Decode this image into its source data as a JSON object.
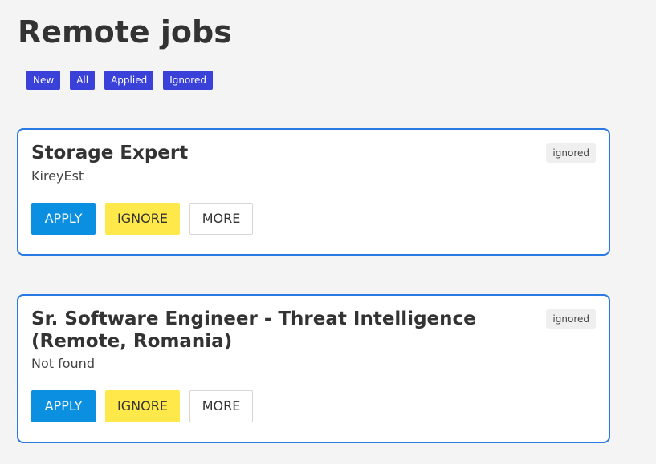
{
  "page": {
    "title": "Remote jobs"
  },
  "filters": [
    {
      "label": "New"
    },
    {
      "label": "All"
    },
    {
      "label": "Applied"
    },
    {
      "label": "Ignored"
    }
  ],
  "jobs": [
    {
      "title": "Storage Expert",
      "company": "KireyEst",
      "status": "ignored",
      "actions": {
        "apply": "APPLY",
        "ignore": "IGNORE",
        "more": "MORE"
      }
    },
    {
      "title": "Sr. Software Engineer - Threat Intelligence (Remote, Romania)",
      "company": "Not found",
      "status": "ignored",
      "actions": {
        "apply": "APPLY",
        "ignore": "IGNORE",
        "more": "MORE"
      }
    }
  ],
  "colors": {
    "background": "#f4f4f4",
    "filter_button": "#3a41d8",
    "card_border": "#2a7ae4",
    "apply_button": "#0b8fe0",
    "ignore_button": "#ffe94a",
    "more_button_border": "#d6d6d6",
    "status_badge": "#efefef"
  }
}
